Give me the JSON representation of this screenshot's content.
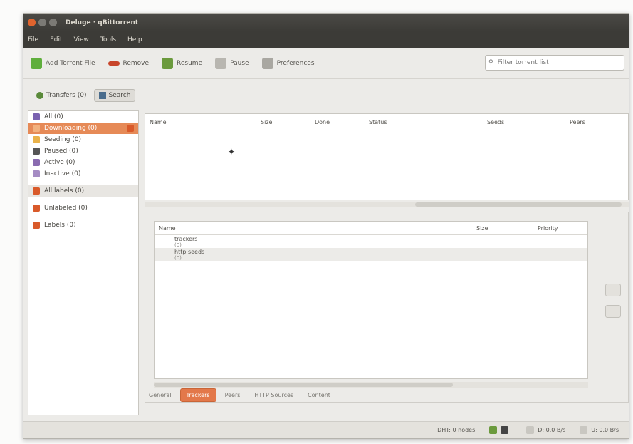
{
  "window": {
    "title": "Deluge · qBittorrent"
  },
  "menu": [
    "File",
    "Edit",
    "View",
    "Tools",
    "Help"
  ],
  "toolbar": {
    "buttons": [
      {
        "label": "Add Torrent File",
        "icon": "add-icon",
        "color": "#5fae3c"
      },
      {
        "label": "Remove",
        "icon": "remove-icon",
        "color": "#c8452a"
      },
      {
        "label": "Resume",
        "icon": "resume-icon",
        "color": "#6b9a3d"
      },
      {
        "label": "Pause",
        "icon": "pause-icon",
        "color": "#8d8a83"
      },
      {
        "label": "Preferences",
        "icon": "preferences-icon",
        "color": "#8d8a83"
      }
    ],
    "search_placeholder": "Filter torrent list"
  },
  "tabs": [
    {
      "label": "Transfers (0)",
      "icon": "transfers-icon"
    },
    {
      "label": "Search",
      "icon": "search-tab-icon"
    }
  ],
  "sidebar": {
    "items": [
      {
        "label": "All (0)",
        "color": "#7a62b0",
        "selected": false
      },
      {
        "label": "Downloading (0)",
        "color": "#e06a2e",
        "selected": true
      },
      {
        "label": "Seeding (0)",
        "color": "#6a9a3c",
        "selected": false
      },
      {
        "label": "Paused (0)",
        "color": "#555",
        "selected": false
      },
      {
        "label": "Active (0)",
        "color": "#8a6bb0",
        "selected": false
      },
      {
        "label": "Inactive (0)",
        "color": "#8a6bb0",
        "selected": false
      }
    ],
    "groups": [
      {
        "label": "All labels (0)",
        "color": "#d95a2a"
      },
      {
        "label": "Unlabeled (0)",
        "color": "#d95a2a"
      },
      {
        "label": "Labels (0)",
        "color": "#d95a2a"
      }
    ]
  },
  "torrent_table": {
    "columns": [
      "Name",
      "Size",
      "Done",
      "Status",
      "Seeds",
      "Peers"
    ]
  },
  "details": {
    "columns": [
      "Name",
      "Size",
      "Priority"
    ],
    "rows": [
      {
        "name": "trackers",
        "sub": "(0)"
      },
      {
        "name": "http seeds",
        "sub": "(0)"
      }
    ]
  },
  "bottom_tabs": [
    "General",
    "Trackers",
    "Peers",
    "HTTP Sources",
    "Content"
  ],
  "status": {
    "dht": "DHT: 0 nodes",
    "down": "D: 0.0 B/s",
    "up": "U: 0.0 B/s"
  }
}
